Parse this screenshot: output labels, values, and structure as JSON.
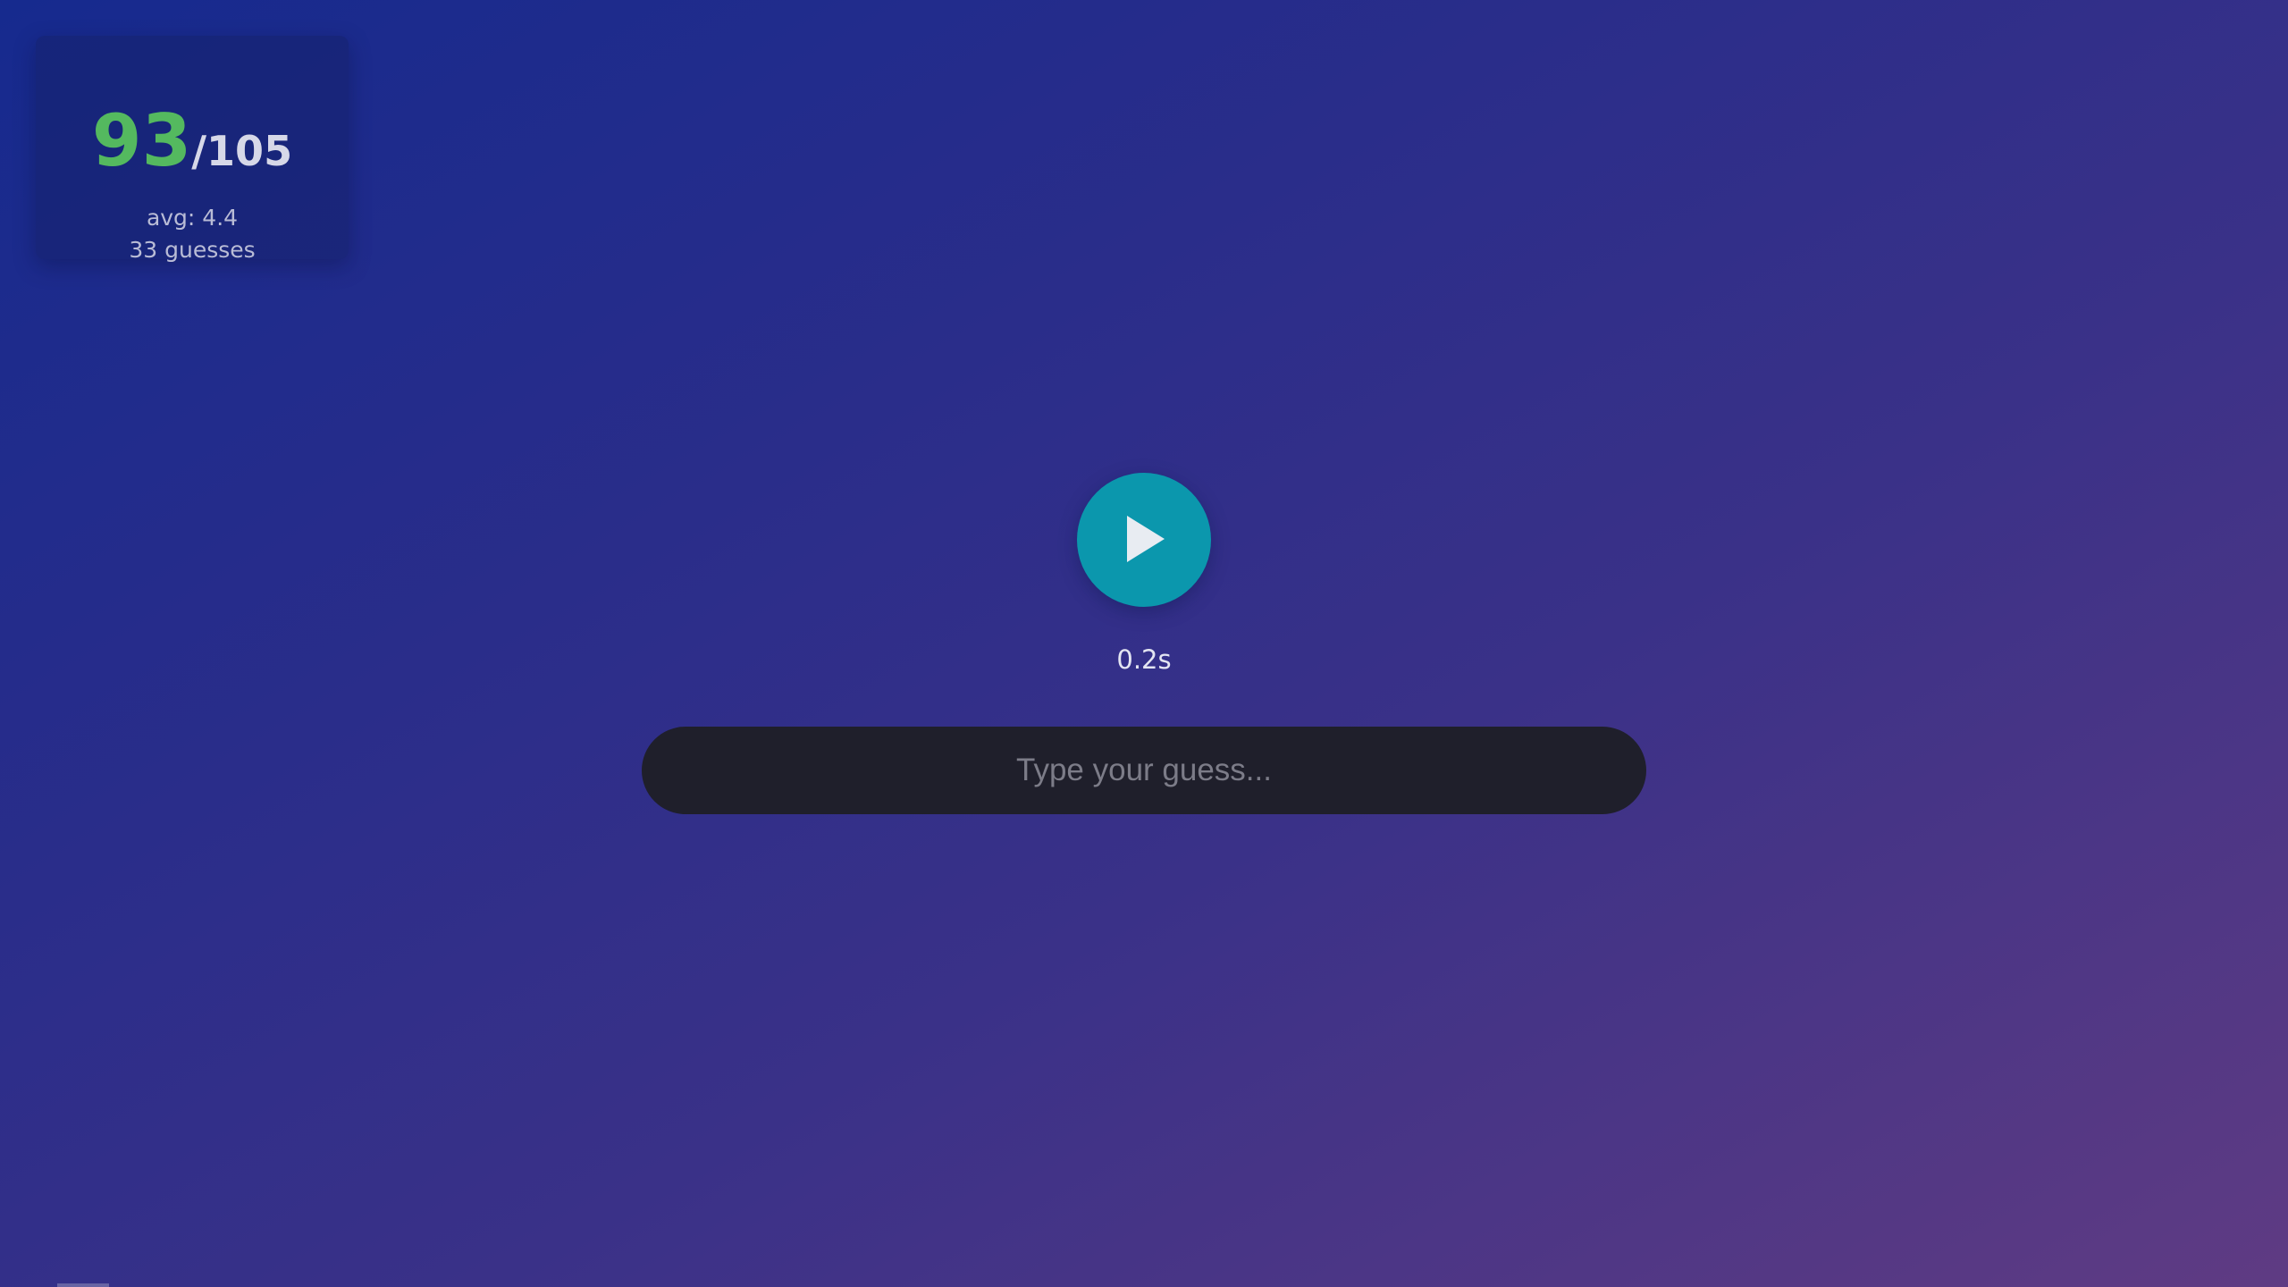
{
  "score": {
    "correct": "93",
    "total": "/105",
    "average": "avg: 4.4",
    "guesses": "33 guesses"
  },
  "player": {
    "play_icon": "play-icon",
    "timer": "0.2s"
  },
  "guess": {
    "value": "",
    "placeholder": "Type your guess..."
  },
  "colors": {
    "score_accent": "#54b95f",
    "play_button": "#0b97ad",
    "input_background": "#1f1f2b"
  }
}
